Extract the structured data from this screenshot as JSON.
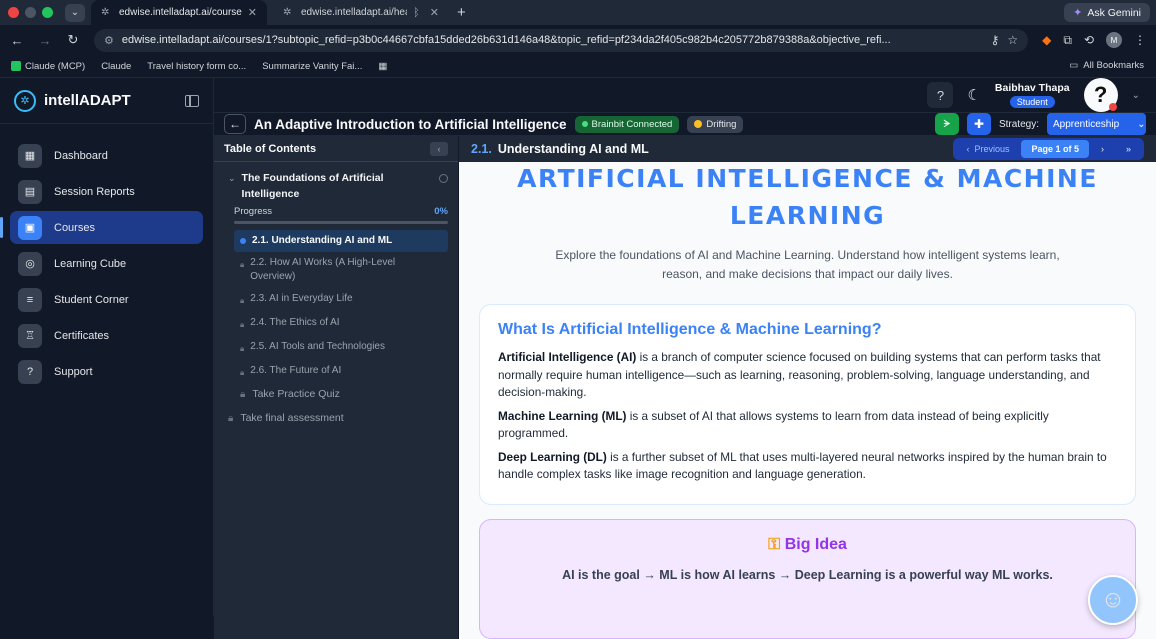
{
  "browser": {
    "tabs": [
      {
        "label": "edwise.intelladapt.ai/courses/",
        "active": true
      },
      {
        "label": "edwise.intelladapt.ai/head",
        "active": false
      }
    ],
    "gemini_label": "Ask Gemini",
    "url": "edwise.intelladapt.ai/courses/1?subtopic_refid=p3b0c44667cbfa15dded26b631d146a48&topic_refid=pf234da2f405c982b4c205772b879388a&objective_refi...",
    "profile_initial": "M",
    "bookmarks": [
      "Claude (MCP)",
      "Claude",
      "Travel history form co...",
      "Summarize Vanity Fai..."
    ],
    "all_bookmarks": "All Bookmarks"
  },
  "app": {
    "brand": "intellADAPT",
    "menu": [
      {
        "label": "Dashboard",
        "icon": "dashboard-icon"
      },
      {
        "label": "Session Reports",
        "icon": "report-icon"
      },
      {
        "label": "Courses",
        "icon": "courses-icon",
        "active": true
      },
      {
        "label": "Learning Cube",
        "icon": "cube-icon"
      },
      {
        "label": "Student Corner",
        "icon": "chart-icon"
      },
      {
        "label": "Certificates",
        "icon": "certificate-icon"
      },
      {
        "label": "Support",
        "icon": "support-icon"
      }
    ],
    "user": {
      "name": "Baibhav Thapa",
      "role": "Student"
    }
  },
  "course": {
    "title": "An Adaptive Introduction to Artificial Intelligence",
    "badge_connected": "Brainbit Connected",
    "badge_drifting": "Drifting",
    "strategy_label": "Strategy:",
    "strategy_value": "Apprenticeship"
  },
  "toc": {
    "title": "Table of Contents",
    "section_title": "The Foundations of Artificial Intelligence",
    "progress_label": "Progress",
    "progress_value": "0%",
    "progress_fraction": 0,
    "lessons": [
      {
        "label": "2.1. Understanding AI and ML",
        "active": true
      },
      {
        "label": "2.2. How AI Works (A High-Level Overview)"
      },
      {
        "label": "2.3. AI in Everyday Life"
      },
      {
        "label": "2.4. The Ethics of AI"
      },
      {
        "label": "2.5. AI Tools and Technologies"
      },
      {
        "label": "2.6. The Future of AI"
      }
    ],
    "quiz": "Take Practice Quiz",
    "final": "Take final assessment"
  },
  "reader": {
    "number": "2.1.",
    "title": "Understanding AI and ML",
    "pager": {
      "prev": "Previous",
      "current": "Page 1 of 5",
      "next": "›",
      "last": "»"
    },
    "hero_title": "ARTIFICIAL INTELLIGENCE & MACHINE LEARNING",
    "hero_sub": "Explore the foundations of AI and Machine Learning. Understand how intelligent systems learn, reason, and make decisions that impact our daily lives.",
    "card_title": "What Is Artificial Intelligence & Machine Learning?",
    "paras": [
      {
        "term": "Artificial Intelligence (AI)",
        "text": " is a branch of computer science focused on building systems that can perform tasks that normally require human intelligence—such as learning, reasoning, problem-solving, language understanding, and decision-making."
      },
      {
        "term": "Machine Learning (ML)",
        "text": " is a subset of AI that allows systems to learn from data instead of being explicitly programmed."
      },
      {
        "term": "Deep Learning (DL)",
        "text": " is a further subset of ML that uses multi-layered neural networks inspired by the human brain to handle complex tasks like image recognition and language generation."
      }
    ],
    "big_idea_title": "Big Idea",
    "big_idea_text": "AI is the goal → ML is how AI learns → Deep Learning is a powerful way ML works."
  }
}
